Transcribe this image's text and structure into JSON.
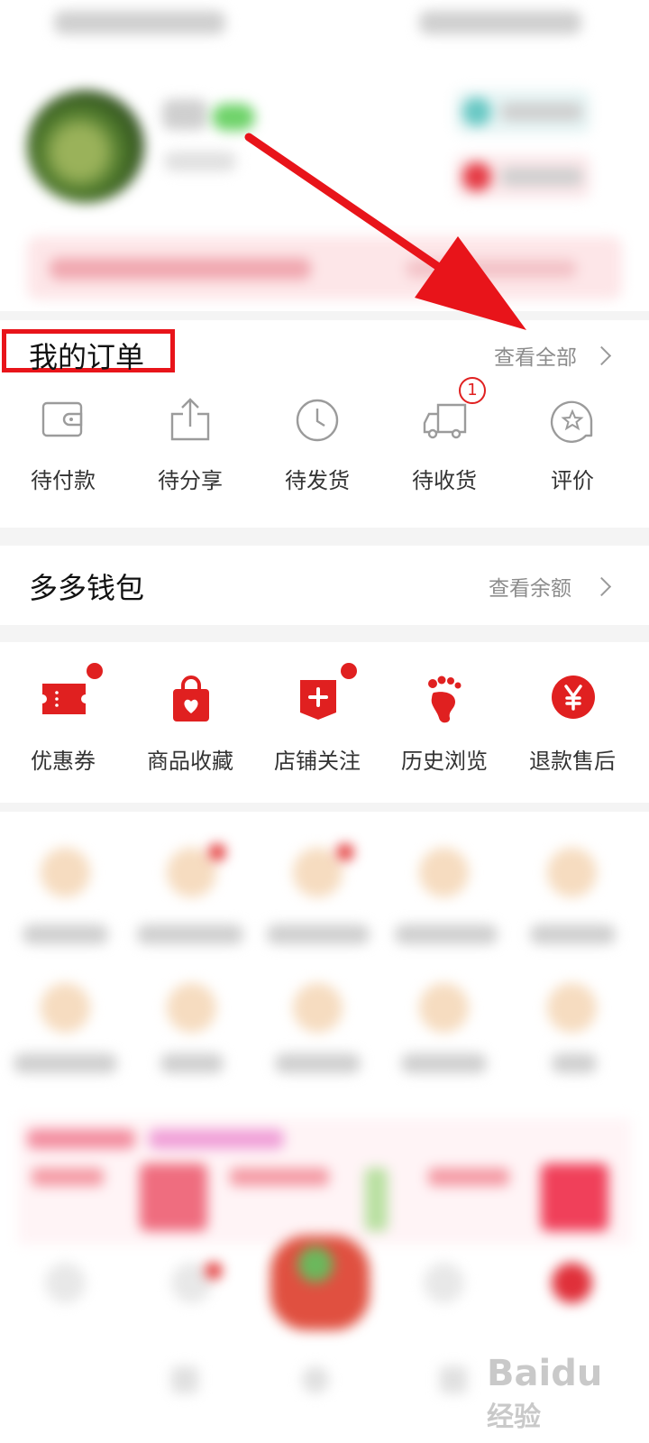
{
  "orders": {
    "title": "我的订单",
    "view_all": "查看全部",
    "items": [
      {
        "label": "待付款",
        "icon": "wallet-icon"
      },
      {
        "label": "待分享",
        "icon": "share-icon"
      },
      {
        "label": "待发货",
        "icon": "clock-icon"
      },
      {
        "label": "待收货",
        "icon": "truck-icon",
        "badge": "1"
      },
      {
        "label": "评价",
        "icon": "review-icon"
      }
    ]
  },
  "wallet": {
    "title": "多多钱包",
    "balance_link": "查看余额"
  },
  "shortcuts": {
    "items": [
      {
        "label": "优惠券",
        "icon": "coupon-icon"
      },
      {
        "label": "商品收藏",
        "icon": "favorites-bag-icon"
      },
      {
        "label": "店铺关注",
        "icon": "store-follow-icon"
      },
      {
        "label": "历史浏览",
        "icon": "footprint-icon"
      },
      {
        "label": "退款售后",
        "icon": "refund-yen-icon"
      }
    ]
  },
  "colors": {
    "accent": "#e02020",
    "annotation": "#e8141a"
  },
  "watermark": {
    "brand": "Baidu",
    "text": "经验"
  }
}
